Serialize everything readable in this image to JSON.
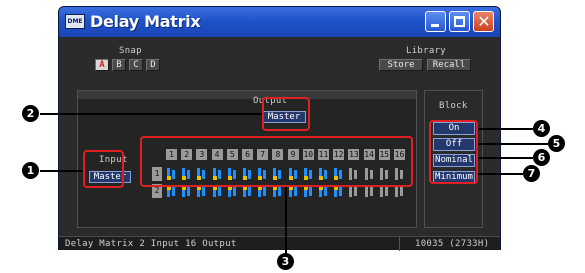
{
  "window": {
    "title": "Delay Matrix",
    "icon_text": "DME"
  },
  "snap": {
    "label": "Snap",
    "buttons": [
      "A",
      "B",
      "C",
      "D"
    ],
    "active": "A"
  },
  "library": {
    "label": "Library",
    "store": "Store",
    "recall": "Recall"
  },
  "output": {
    "label": "Output",
    "master": "Master"
  },
  "input": {
    "label": "Input",
    "master": "Master"
  },
  "block": {
    "label": "Block",
    "on": "On",
    "off": "Off",
    "nominal": "Nominal",
    "minimum": "Minimum"
  },
  "matrix": {
    "columns": [
      "1",
      "2",
      "3",
      "4",
      "5",
      "6",
      "7",
      "8",
      "9",
      "10",
      "11",
      "12",
      "13",
      "14",
      "15",
      "16"
    ],
    "rows": [
      "1",
      "2"
    ],
    "assigned_columns": 12
  },
  "status": {
    "left": "Delay Matrix   2 Input 16 Output",
    "right": "10035 (2733H)"
  },
  "callouts": [
    "1",
    "2",
    "3",
    "4",
    "5",
    "6",
    "7"
  ],
  "colors": {
    "assigned": "#1e90ff",
    "empty": "#9a9a9a",
    "highlight": "#e02020",
    "title": "#1f53c9"
  }
}
